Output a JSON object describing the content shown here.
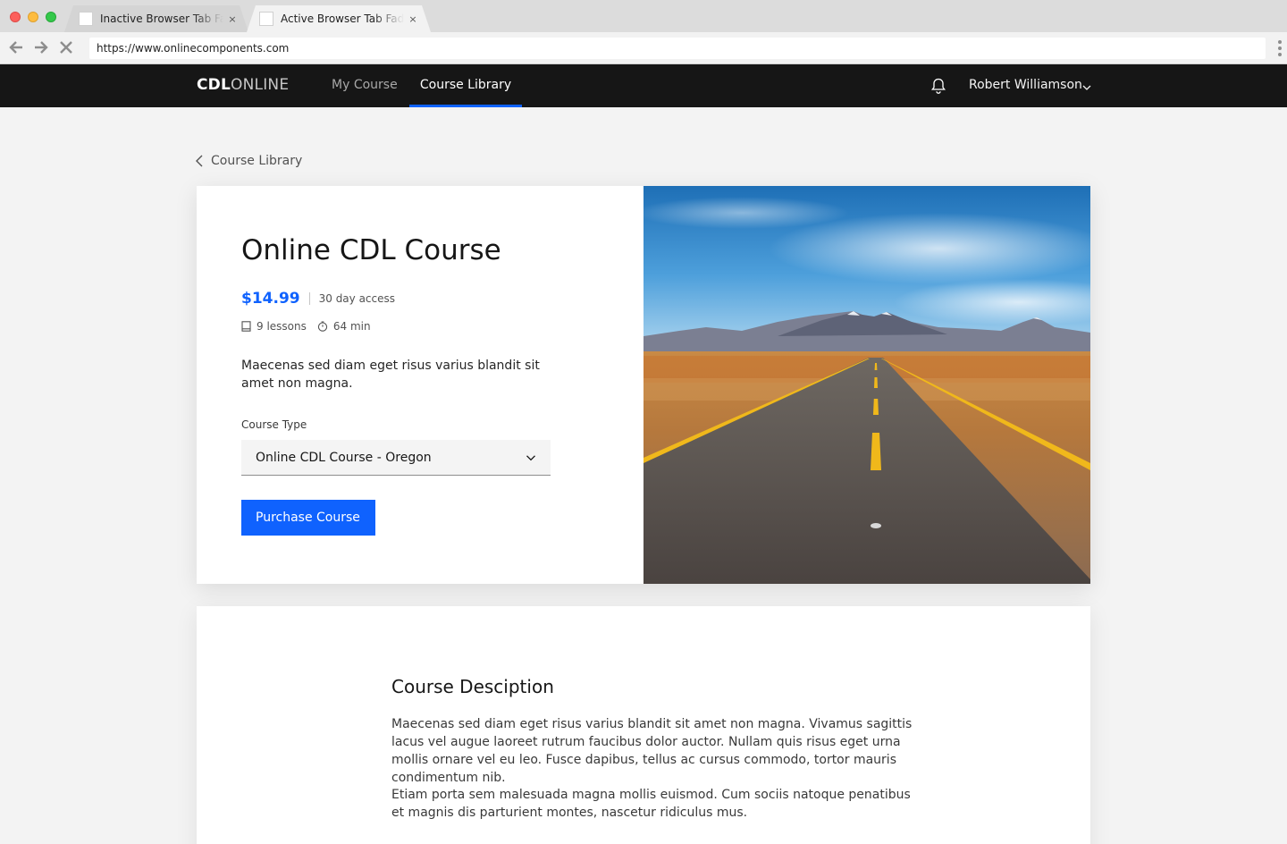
{
  "browser": {
    "tabs": [
      {
        "title": "Inactive Browser Tab Fade",
        "active": false
      },
      {
        "title": "Active Browser Tab Fade",
        "active": true
      }
    ],
    "close_glyph": "×",
    "url": "https://www.onlinecomponents.com",
    "nav_icons": [
      "arrow-left-icon",
      "arrow-right-icon",
      "close-icon",
      "kebab-menu-icon"
    ]
  },
  "header": {
    "brand_bold": "CDL",
    "brand_light": "ONLINE",
    "nav": [
      {
        "label": "My Course",
        "active": false
      },
      {
        "label": "Course Library",
        "active": true
      }
    ],
    "user_name": "Robert Williamson",
    "icons": [
      "bell-icon",
      "chevron-down-icon"
    ]
  },
  "breadcrumb": {
    "label": "Course Library"
  },
  "course": {
    "title": "Online CDL Course",
    "price": "$14.99",
    "access": "30 day access",
    "lessons": "9 lessons",
    "duration": "64 min",
    "summary": "Maecenas sed diam eget risus varius blandit sit amet non magna.",
    "course_type_label": "Course Type",
    "course_type_value": "Online CDL Course - Oregon",
    "purchase_label": "Purchase Course"
  },
  "description": {
    "title": "Course Desciption",
    "paragraphs": [
      "Maecenas sed diam eget risus varius blandit sit amet non magna. Vivamus sagittis lacus vel augue laoreet rutrum faucibus dolor auctor. Nullam quis risus eget urna mollis ornare vel eu leo. Fusce dapibus, tellus ac cursus commodo, tortor mauris condimentum nib.",
      "Etiam porta sem malesuada magna mollis euismod. Cum sociis natoque penatibus et magnis dis parturient montes, nascetur ridiculus mus."
    ]
  },
  "colors": {
    "accent": "#0f62fe",
    "header_bg": "#161616",
    "page_bg": "#f3f3f3"
  }
}
